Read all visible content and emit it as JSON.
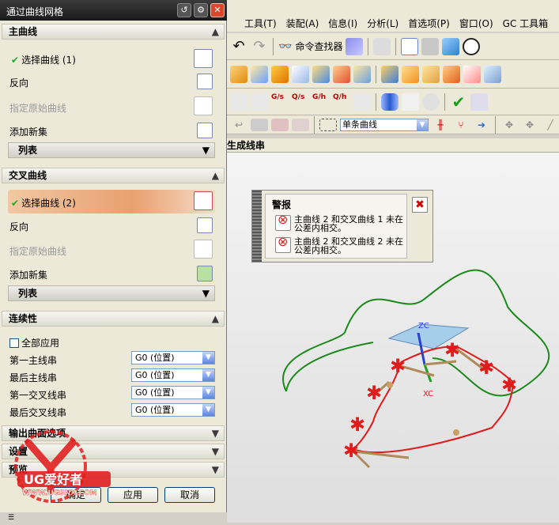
{
  "dialog": {
    "title": "通过曲线网格",
    "sections": {
      "primary": {
        "header": "主曲线",
        "select_curve": "选择曲线 (1)",
        "reverse": "反向",
        "specify_origin": "指定原始曲线",
        "add_new_set": "添加新集",
        "list": "列表"
      },
      "cross": {
        "header": "交叉曲线",
        "select_curve": "选择曲线 (2)",
        "reverse": "反向",
        "specify_origin": "指定原始曲线",
        "add_new_set": "添加新集",
        "list": "列表"
      },
      "continuity": {
        "header": "连续性",
        "apply_all": "全部应用",
        "rows": [
          {
            "label": "第一主线串",
            "value": "G0 (位置)"
          },
          {
            "label": "最后主线串",
            "value": "G0 (位置)"
          },
          {
            "label": "第一交叉线串",
            "value": "G0 (位置)"
          },
          {
            "label": "最后交叉线串",
            "value": "G0 (位置)"
          }
        ]
      },
      "output": {
        "header": "输出曲面选项"
      },
      "settings": {
        "header": "设置"
      },
      "preview": {
        "header": "预览"
      }
    },
    "buttons": {
      "ok": "确定",
      "apply": "应用",
      "cancel": "取消"
    }
  },
  "menu": {
    "items": [
      "工具(T)",
      "装配(A)",
      "信息(I)",
      "分析(L)",
      "首选项(P)",
      "窗口(O)",
      "GC 工具箱"
    ]
  },
  "toolbar": {
    "command_finder": "命令查找器",
    "selection_filter": "单条曲线",
    "tab_label": "生成线串",
    "gs_labels": [
      "G/s",
      "Q/s",
      "G/h",
      "Q/h"
    ]
  },
  "warning": {
    "title": "警报",
    "messages": [
      "主曲线 2 和交叉曲线 1 未在公差内相交。",
      "主曲线 2 和交叉曲线 2 未在公差内相交。"
    ]
  },
  "viewport": {
    "axis_labels": [
      "ZC",
      "XC"
    ]
  },
  "watermark": {
    "brand": "UG爱好者",
    "url": "WWW.UGSNX.COM"
  },
  "colors": {
    "green_curve": "#1a8a1a",
    "red_curve": "#e01b1b",
    "plane": "#8fc3ea"
  }
}
